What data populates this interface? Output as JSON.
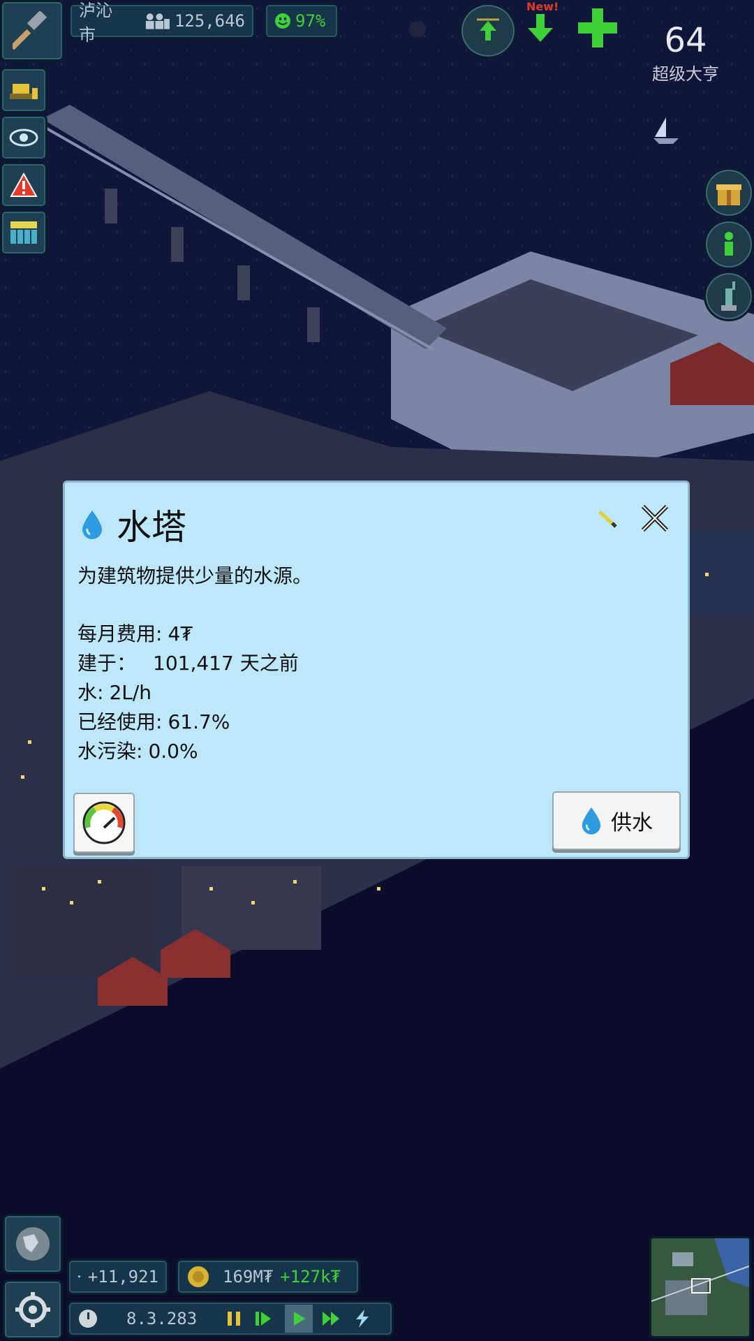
{
  "hud": {
    "city_name": "泸沁市",
    "population": "125,646",
    "happiness": "97%",
    "notification": "New!",
    "rank_number": "64",
    "rank_label": "超级大亨"
  },
  "dialog": {
    "title": "水塔",
    "description": "为建筑物提供少量的水源。",
    "stats": [
      {
        "label": "每月费用:",
        "value": "4₮"
      },
      {
        "label": "建于：",
        "value": "101,417 天之前"
      },
      {
        "label": "水:",
        "value": "2L/h"
      },
      {
        "label": "已经使用:",
        "value": "61.7%"
      },
      {
        "label": "水污染:",
        "value": "0.0%"
      }
    ],
    "supply_button_label": "供水"
  },
  "bottom": {
    "diamonds": "+11,921",
    "money": "169M₮",
    "income": "+127k₮",
    "date": "8.3.283"
  },
  "colors": {
    "dialog_bg": "#bde8fb",
    "night_bg": "#0d1230",
    "hud_bg": "#1f3f52",
    "green": "#3fd03a",
    "water_blue": "#2e9be0"
  }
}
